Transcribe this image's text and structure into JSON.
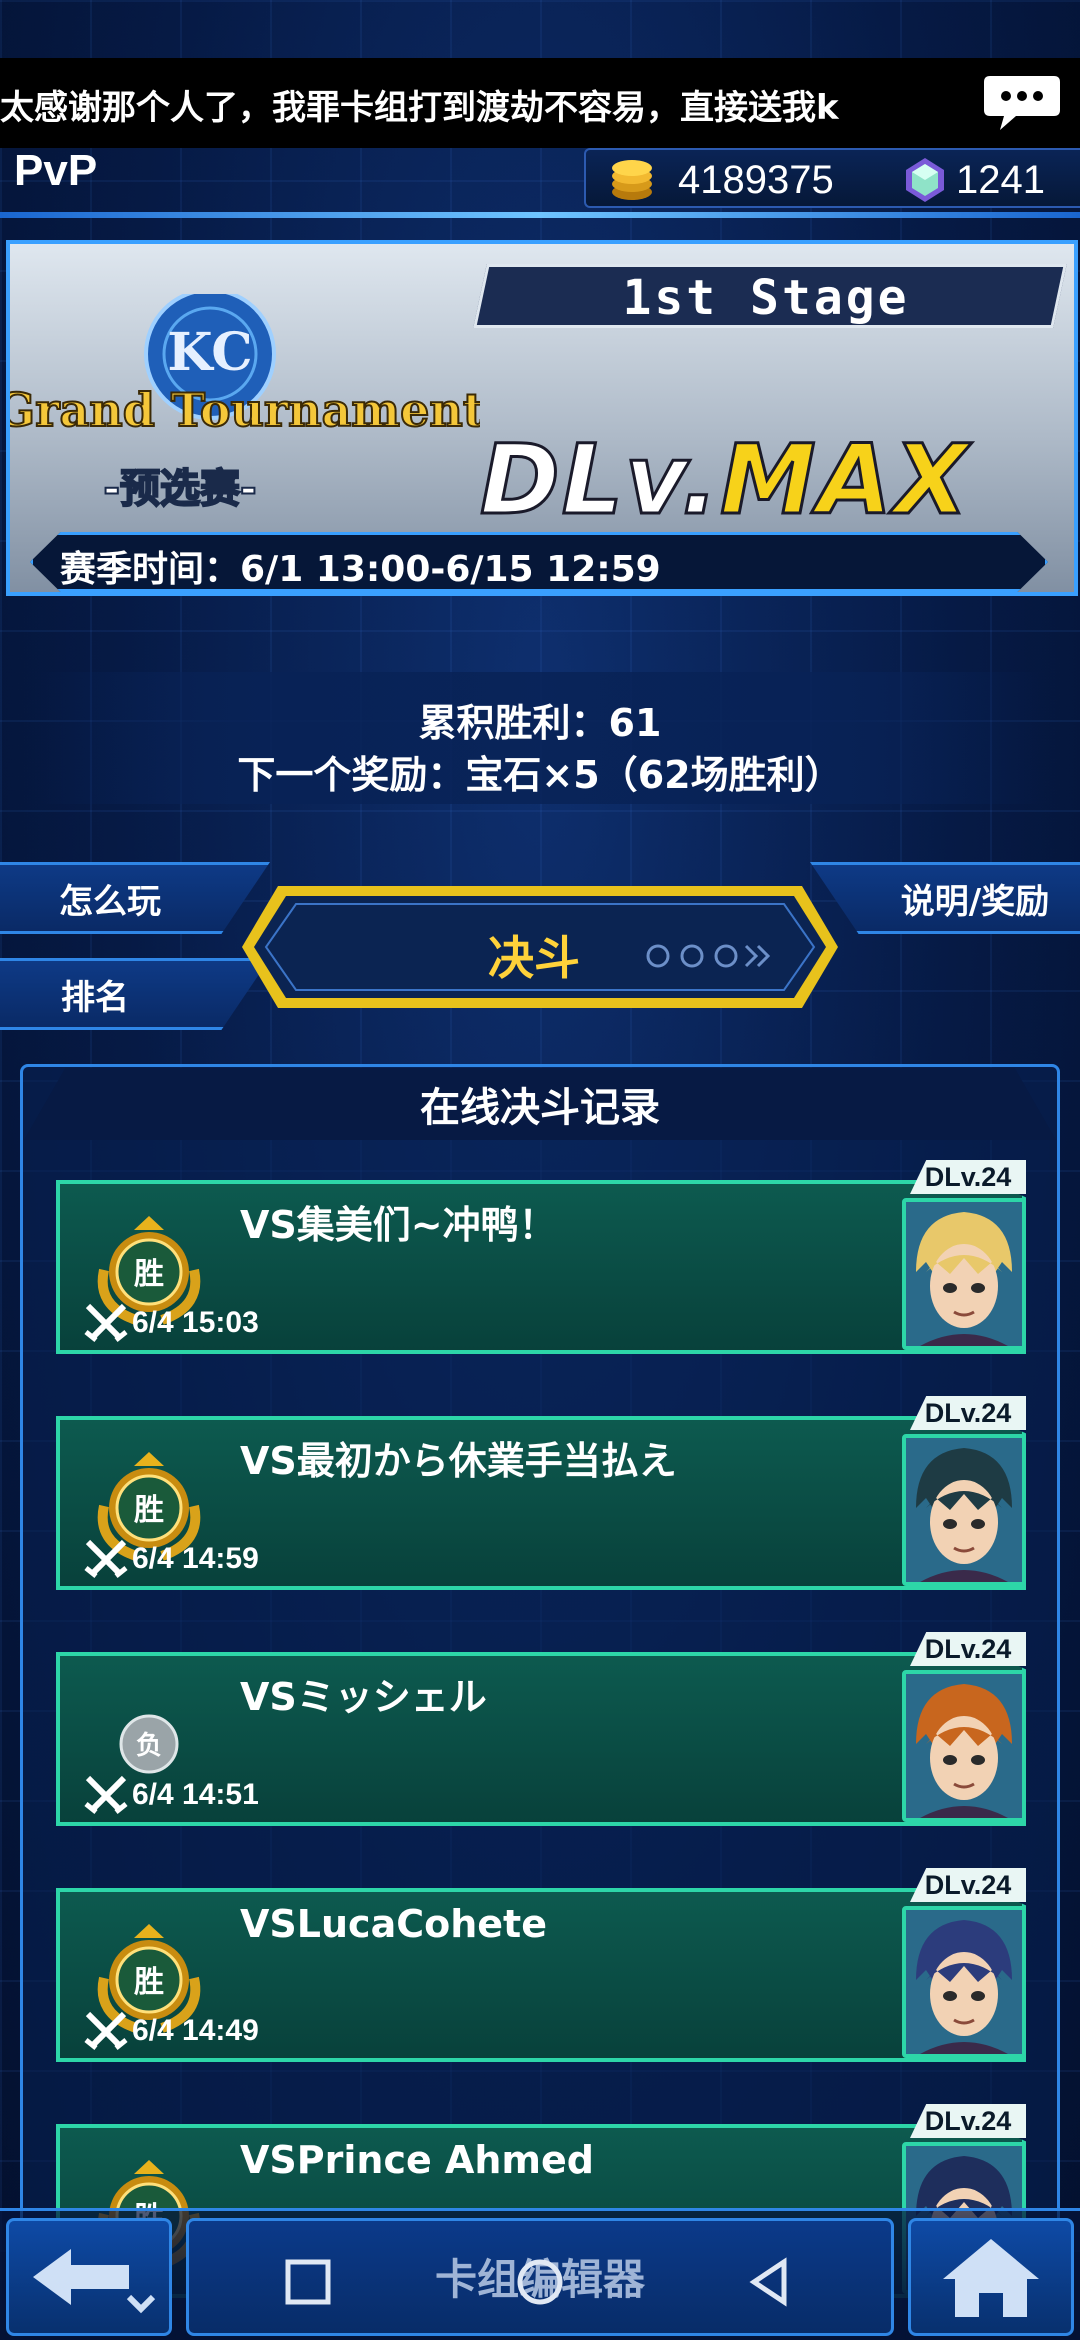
{
  "ticker": {
    "message": "太感谢那个人了，我罪卡组打到渡劫不容易，直接送我k"
  },
  "header": {
    "mode_label": "PvP",
    "gold_amount": "4189375",
    "gem_amount": "1241"
  },
  "banner": {
    "logo_top": "KC",
    "logo_title": "Grand Tournament",
    "logo_sub": "-预选赛-",
    "stage": "1st Stage",
    "dlv_prefix": "DLv.",
    "dlv_max": "MAX",
    "season": "赛季时间：6/1 13:00-6/15 12:59"
  },
  "wins": {
    "total": "累积胜利：61",
    "next_reward": "下一个奖励：宝石×5（62场胜利）"
  },
  "tabs": {
    "how_to_play": "怎么玩",
    "ranking": "排名",
    "info_rewards": "说明/奖励",
    "duel": "决斗"
  },
  "records": {
    "title": "在线决斗记录",
    "items": [
      {
        "dlv": "DLv.24",
        "opponent": "VS集美们~冲鸭！",
        "time": "6/4 15:03",
        "result": "胜",
        "win": true,
        "avatar_color": "#e8c86a",
        "avatar": "blonde-duelist"
      },
      {
        "dlv": "DLv.24",
        "opponent": "VS最初から休業手当払え",
        "time": "6/4 14:59",
        "result": "胜",
        "win": true,
        "avatar_color": "#1e3b44",
        "avatar": "dark-haired-duelist"
      },
      {
        "dlv": "DLv.24",
        "opponent": "VSミッシェル",
        "time": "6/4 14:51",
        "result": "负",
        "win": false,
        "avatar_color": "#c8661e",
        "avatar": "orange-haired-duelist"
      },
      {
        "dlv": "DLv.24",
        "opponent": "VSLucaCohete",
        "time": "6/4 14:49",
        "result": "胜",
        "win": true,
        "avatar_color": "#2c3c7c",
        "avatar": "blue-haired-duelist"
      },
      {
        "dlv": "DLv.24",
        "opponent": "VSPrince Ahmed",
        "time": "",
        "result": "胜",
        "win": true,
        "avatar_color": "#1e2e5c",
        "avatar": "prince-duelist"
      }
    ]
  },
  "bottom_nav": {
    "deck_edit": "卡组编辑器"
  },
  "colors": {
    "accent_blue": "#2f86e6",
    "card_green": "#2dd6a8",
    "duel_gold": "#ffd23a",
    "win_gold": "#d9a21a"
  }
}
